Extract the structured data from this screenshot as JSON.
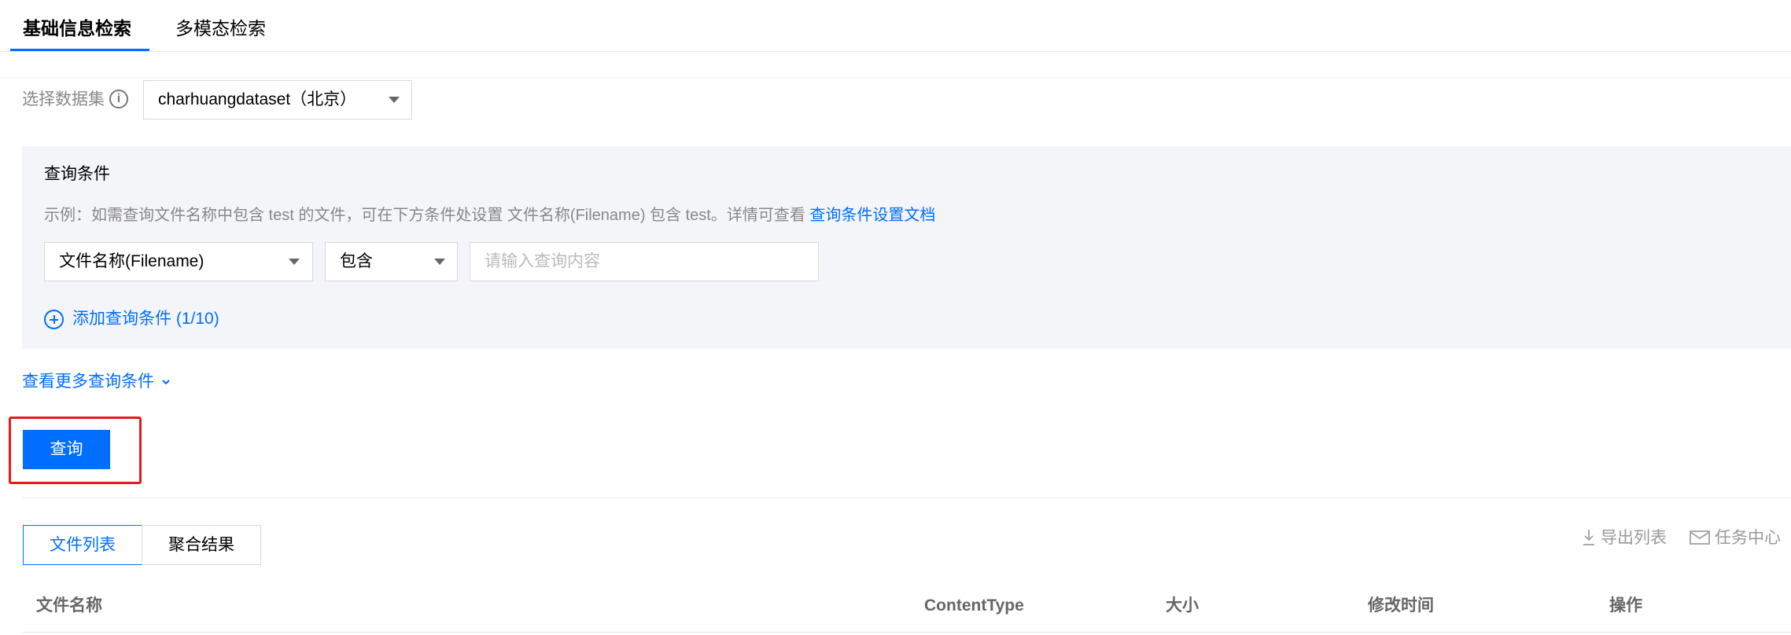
{
  "tabs": [
    {
      "label": "基础信息检索",
      "active": true
    },
    {
      "label": "多模态检索",
      "active": false
    }
  ],
  "dataset": {
    "label": "选择数据集",
    "info_icon": "info-circle-icon",
    "selected": "charhuangdataset（北京）"
  },
  "query_panel": {
    "title": "查询条件",
    "hint_prefix": "示例：如需查询文件名称中包含 test 的文件，可在下方条件处设置 文件名称(Filename) 包含 test。详情可查看 ",
    "hint_link": "查询条件设置文档",
    "condition": {
      "field": "文件名称(Filename)",
      "operator": "包含",
      "value_placeholder": "请输入查询内容"
    },
    "add_condition": "添加查询条件 (1/10)"
  },
  "more_conditions": "查看更多查询条件",
  "query_button": "查询",
  "result_tabs": [
    {
      "label": "文件列表",
      "active": true
    },
    {
      "label": "聚合结果",
      "active": false
    }
  ],
  "toolbar": {
    "export": "导出列表",
    "task_center": "任务中心"
  },
  "table": {
    "columns": [
      "文件名称",
      "ContentType",
      "大小",
      "修改时间",
      "操作"
    ]
  },
  "colors": {
    "accent": "#006eff",
    "highlight_box": "#e21b1b",
    "panel_bg": "#f4f5f8"
  }
}
